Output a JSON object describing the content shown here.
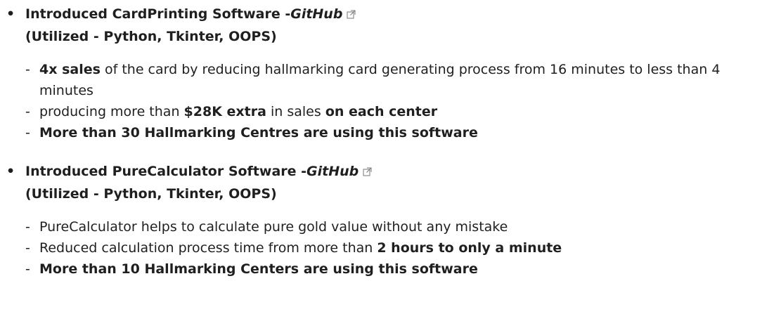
{
  "projects": [
    {
      "title": "Introduced CardPrinting Software -",
      "github_label": "GitHub",
      "tech": "(Utilized - Python, Tkinter, OOPS)",
      "points": [
        {
          "parts": [
            {
              "text": "4x sales",
              "bold": true
            },
            {
              "text": " of the card by reducing hallmarking card generating process from 16 minutes to less than 4 minutes",
              "bold": false
            }
          ]
        },
        {
          "parts": [
            {
              "text": "producing more than ",
              "bold": false
            },
            {
              "text": "$28K extra",
              "bold": true
            },
            {
              "text": " in sales ",
              "bold": false
            },
            {
              "text": "on each center",
              "bold": true
            }
          ]
        },
        {
          "parts": [
            {
              "text": "More than 30 Hallmarking Centres are using this software",
              "bold": true
            }
          ]
        }
      ]
    },
    {
      "title": "Introduced PureCalculator Software -",
      "github_label": "GitHub",
      "tech": "(Utilized - Python, Tkinter, OOPS)",
      "points": [
        {
          "parts": [
            {
              "text": "PureCalculator helps to calculate pure gold value without any mistake",
              "bold": false
            }
          ]
        },
        {
          "parts": [
            {
              "text": "Reduced calculation process time from more than ",
              "bold": false
            },
            {
              "text": "2 hours to only a minute",
              "bold": true
            }
          ]
        },
        {
          "parts": [
            {
              "text": "More than 10 Hallmarking Centers are using this software",
              "bold": true
            }
          ]
        }
      ]
    }
  ],
  "bullet_char": "•",
  "dash_char": "-",
  "icons": {
    "external_link": "external-link-icon"
  }
}
